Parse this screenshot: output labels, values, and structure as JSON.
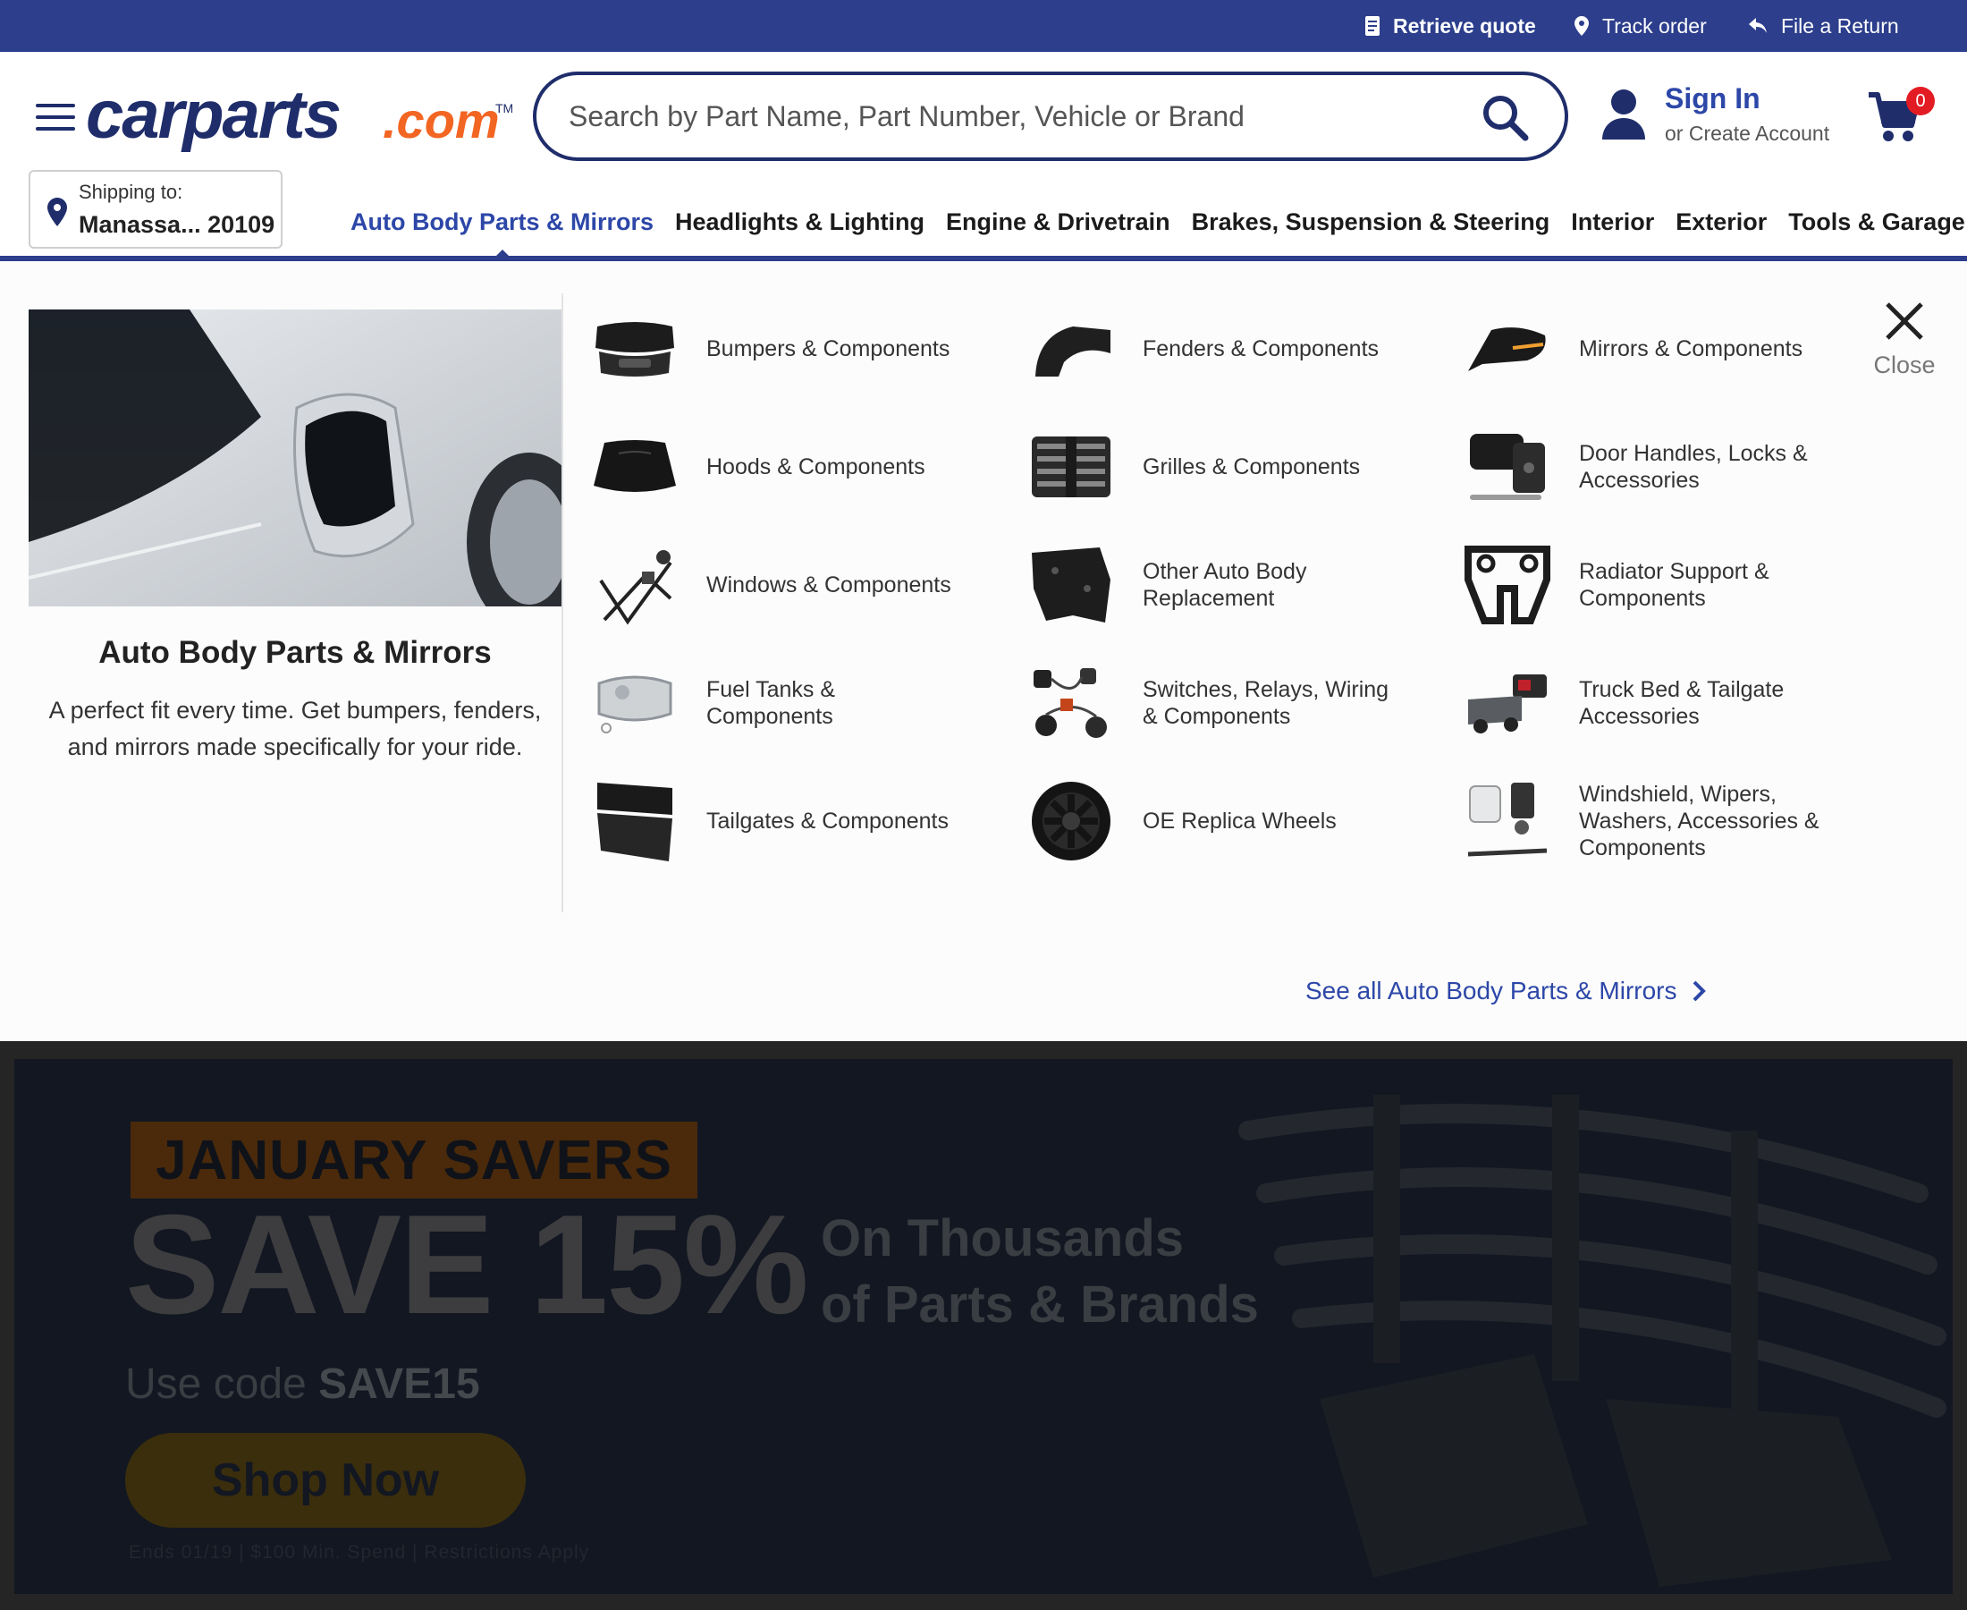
{
  "topbar": {
    "retrieve_quote": "Retrieve quote",
    "track_order": "Track order",
    "file_return": "File a Return"
  },
  "header": {
    "logo_text": "carparts",
    "logo_suffix": ".com",
    "logo_tm": "TM",
    "search_placeholder": "Search by Part Name, Part Number, Vehicle or Brand",
    "sign_in": "Sign In",
    "create_account": "or Create Account",
    "cart_count": "0"
  },
  "shipping": {
    "label": "Shipping to:",
    "location": "Manassa... 20109"
  },
  "nav": {
    "items": [
      {
        "label": "Auto Body Parts & Mirrors"
      },
      {
        "label": "Headlights & Lighting"
      },
      {
        "label": "Engine & Drivetrain"
      },
      {
        "label": "Brakes, Suspension & Steering"
      },
      {
        "label": "Interior"
      },
      {
        "label": "Exterior"
      },
      {
        "label": "Tools & Garage"
      }
    ]
  },
  "menu": {
    "feature_title": "Auto Body Parts & Mirrors",
    "feature_desc": "A perfect fit every time. Get bumpers, fenders, and mirrors made specifically for your ride.",
    "categories": [
      {
        "label": "Bumpers & Components",
        "icon": "bumper-icon"
      },
      {
        "label": "Fenders & Components",
        "icon": "fender-icon"
      },
      {
        "label": "Mirrors & Components",
        "icon": "mirror-icon"
      },
      {
        "label": "Hoods & Components",
        "icon": "hood-icon"
      },
      {
        "label": "Grilles & Components",
        "icon": "grille-icon"
      },
      {
        "label": "Door Handles, Locks & Accessories",
        "icon": "door-handle-icon"
      },
      {
        "label": "Windows & Components",
        "icon": "window-regulator-icon"
      },
      {
        "label": "Other Auto Body Replacement",
        "icon": "body-panel-icon"
      },
      {
        "label": "Radiator Support & Components",
        "icon": "radiator-support-icon"
      },
      {
        "label": "Fuel Tanks & Components",
        "icon": "fuel-tank-icon"
      },
      {
        "label": "Switches, Relays, Wiring & Components",
        "icon": "wiring-icon"
      },
      {
        "label": "Truck Bed & Tailgate Accessories",
        "icon": "truck-bed-icon"
      },
      {
        "label": "Tailgates & Components",
        "icon": "tailgate-icon"
      },
      {
        "label": "OE Replica Wheels",
        "icon": "wheel-icon"
      },
      {
        "label": "Windshield, Wipers, Washers, Accessories & Components",
        "icon": "windshield-wiper-icon"
      }
    ],
    "close_label": "Close",
    "see_all": "See all Auto Body Parts & Mirrors"
  },
  "promo": {
    "badge": "JANUARY SAVERS",
    "headline": "SAVE 15%",
    "subline_1": "On Thousands",
    "subline_2": "of Parts & Brands",
    "use_code_prefix": "Use code ",
    "code": "SAVE15",
    "cta": "Shop Now",
    "fine_print": "Ends 01/19 | $100 Min. Spend | Restrictions Apply"
  },
  "colors": {
    "brand_navy": "#2c3e8c",
    "link_blue": "#2d47a8",
    "logo_orange": "#f26522",
    "cart_badge": "#e31b23"
  }
}
